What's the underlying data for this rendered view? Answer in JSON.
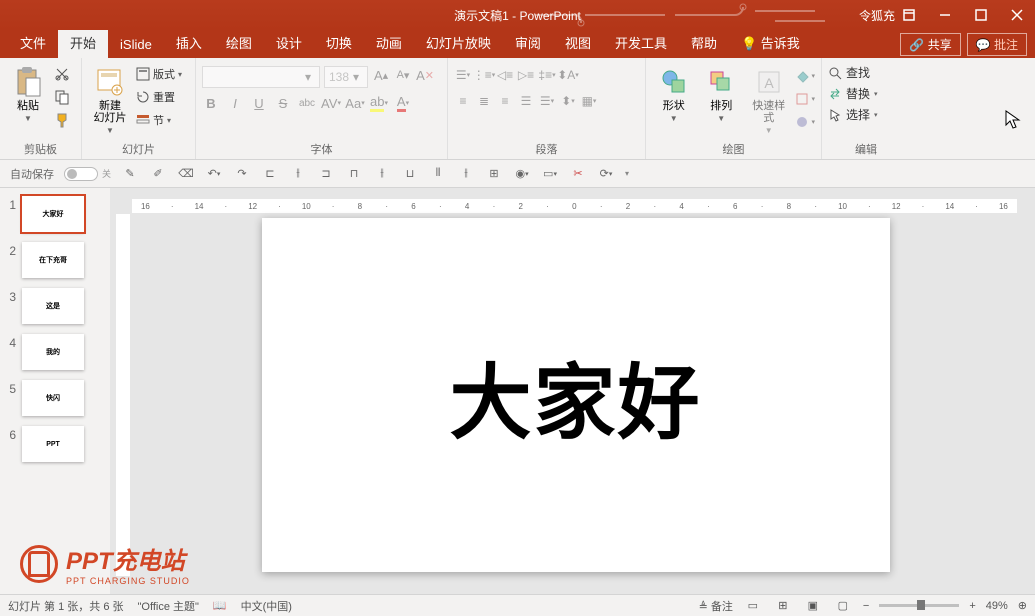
{
  "title": "演示文稿1  -  PowerPoint",
  "user": "令狐充",
  "tabs": {
    "file": "文件",
    "home": "开始",
    "islide": "iSlide",
    "insert": "插入",
    "draw": "绘图",
    "design": "设计",
    "transitions": "切换",
    "animations": "动画",
    "slideshow": "幻灯片放映",
    "review": "审阅",
    "view": "视图",
    "developer": "开发工具",
    "help": "帮助",
    "tellme": "告诉我"
  },
  "share": "共享",
  "comment": "批注",
  "groups": {
    "clipboard": {
      "label": "剪贴板",
      "paste": "粘贴"
    },
    "slides": {
      "label": "幻灯片",
      "new": "新建\n幻灯片",
      "layout": "版式",
      "reset": "重置",
      "section": "节"
    },
    "font": {
      "label": "字体",
      "size": "138"
    },
    "paragraph": {
      "label": "段落"
    },
    "drawing": {
      "label": "绘图",
      "shapes": "形状",
      "arrange": "排列",
      "styles": "快速样式"
    },
    "editing": {
      "label": "编辑",
      "find": "查找",
      "replace": "替换",
      "select": "选择"
    }
  },
  "autosave": "自动保存",
  "autosave_state": "关",
  "thumbs": [
    {
      "n": "1",
      "t": "大家好",
      "sel": true
    },
    {
      "n": "2",
      "t": "在下充哥"
    },
    {
      "n": "3",
      "t": "这是"
    },
    {
      "n": "4",
      "t": "我的"
    },
    {
      "n": "5",
      "t": "快闪"
    },
    {
      "n": "6",
      "t": "PPT"
    }
  ],
  "slide_text": "大家好",
  "status": {
    "slide": "幻灯片 第 1 张，共 6 张",
    "theme": "\"Office 主题\"",
    "lang": "中文(中国)",
    "notes": "备注",
    "zoom": "49%"
  },
  "watermark": {
    "main": "PPT充电站",
    "sub": "PPT CHARGING STUDIO"
  },
  "ruler_ticks": [
    "16",
    "14",
    "12",
    "10",
    "8",
    "6",
    "4",
    "2",
    "0",
    "2",
    "4",
    "6",
    "8",
    "10",
    "12",
    "14",
    "16"
  ]
}
